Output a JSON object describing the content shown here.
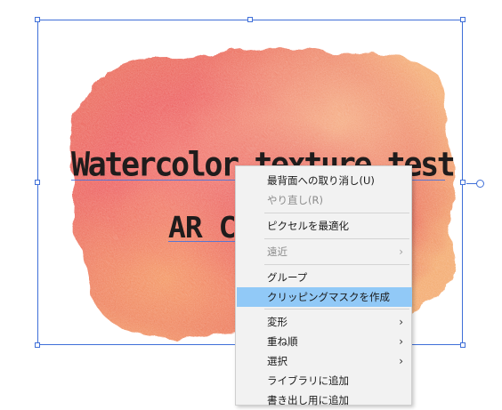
{
  "artboard": {
    "title_text": "Watercolor texture test",
    "subtitle_text": "AR C"
  },
  "colors": {
    "selection": "#3f6fd8",
    "menu_background": "#f2f2f2",
    "menu_highlight": "#91c9f7",
    "text_fill": "#1f1c1c"
  },
  "context_menu": {
    "items": [
      {
        "label": "最背面への取り消し(U)",
        "enabled": true
      },
      {
        "label": "やり直し(R)",
        "enabled": false
      },
      {
        "label": "ピクセルを最適化",
        "enabled": true
      },
      {
        "label": "遠近",
        "enabled": false,
        "submenu": true
      },
      {
        "label": "グループ",
        "enabled": true
      },
      {
        "label": "クリッピングマスクを作成",
        "enabled": true,
        "highlighted": true
      },
      {
        "label": "変形",
        "enabled": true,
        "submenu": true
      },
      {
        "label": "重ね順",
        "enabled": true,
        "submenu": true
      },
      {
        "label": "選択",
        "enabled": true,
        "submenu": true
      },
      {
        "label": "ライブラリに追加",
        "enabled": true
      },
      {
        "label": "書き出し用に追加",
        "enabled": true
      }
    ],
    "submenu_arrow": "›"
  }
}
